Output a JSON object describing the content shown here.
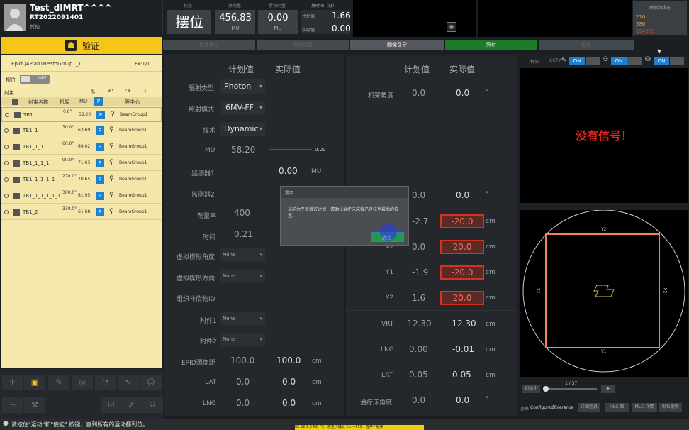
{
  "patient": {
    "name": "Test_dIMRT^^^^",
    "id": "RT2022091401",
    "category": "其他"
  },
  "status": {
    "state_label": "状态",
    "state_value": "摆位",
    "total_label": "总剂量",
    "total_value": "456.83",
    "total_unit": "MU",
    "cum_label": "累积剂量",
    "cum_value": "0.00",
    "cum_unit": "MU",
    "time_label": "总时间（分）",
    "plan_label": "计划值",
    "plan_value": "1.66",
    "actual_label": "实际值",
    "actual_value": "0.00"
  },
  "linkstatus": {
    "title": "联锁和状态",
    "v1": "210",
    "v2": "280",
    "v3": "194000"
  },
  "verify_label": "验证",
  "workflow": [
    "患者摆位",
    "预先设置",
    "图像引导",
    "照射",
    "记录"
  ],
  "plan": {
    "name": "EpidQAPlan1BeamGroup1_1",
    "fx": "Fx:1/1",
    "setup_label": "摆位",
    "toggle": "OFF",
    "beam_label": "射束"
  },
  "beam_headers": {
    "name": "射束名称",
    "gantry": "机架",
    "mu": "MU",
    "p": "P",
    "iso": "等中心"
  },
  "beams": [
    {
      "name": "TB1",
      "gantry": "0.0°",
      "mu": "58.20",
      "p": "P",
      "group": "BeamGroup1"
    },
    {
      "name": "TB1_1",
      "gantry": "30.0°",
      "mu": "63.69",
      "p": "P",
      "group": "BeamGroup1"
    },
    {
      "name": "TB1_1_1",
      "gantry": "60.0°",
      "mu": "69.02",
      "p": "P",
      "group": "BeamGroup1"
    },
    {
      "name": "TB1_1_1_1",
      "gantry": "90.0°",
      "mu": "71.63",
      "p": "P",
      "group": "BeamGroup1"
    },
    {
      "name": "TB1_1_1_1_1",
      "gantry": "270.0°",
      "mu": "70.65",
      "p": "P",
      "group": "BeamGroup1"
    },
    {
      "name": "TB1_1_1_1_1_1",
      "gantry": "300.0°",
      "mu": "61.95",
      "p": "P",
      "group": "BeamGroup1"
    },
    {
      "name": "TB1_2",
      "gantry": "330.0°",
      "mu": "61.68",
      "p": "P",
      "group": "BeamGroup1"
    }
  ],
  "left_col": {
    "plan_hdr": "计划值",
    "act_hdr": "实际值",
    "radtype_label": "辐射类型",
    "radtype": "Photon",
    "mode_label": "照射模式",
    "mode": "6MV-FF",
    "tech_label": "技术",
    "tech": "Dynamic",
    "mu_label": "MU",
    "mu_plan": "58.20",
    "mu_prog": "0.00",
    "m1_label": "监测器1",
    "m1_act": "0.00",
    "m1_unit": "MU",
    "m2_label": "监测器2",
    "rate_label": "剂量率",
    "rate_plan": "400",
    "time_label": "时间",
    "time_plan": "0.21",
    "wedge_angle_label": "虚拟楔形角度",
    "wedge_angle": "None",
    "wedge_dir_label": "虚拟楔形方向",
    "wedge_dir": "None",
    "comp_label": "组织补偿物ID",
    "acc1_label": "附件1",
    "acc1": "None",
    "acc2_label": "附件2",
    "acc2": "None",
    "epid_label": "EPID源像距",
    "epid_plan": "100.0",
    "epid_act": "100.0",
    "epid_unit": "cm",
    "lat_label": "LAT",
    "lat_plan": "0.0",
    "lat_act": "0.0",
    "lat_unit": "cm",
    "lng_label": "LNG",
    "lng_plan": "0.0",
    "lng_act": "0.0",
    "lng_unit": "cm"
  },
  "right_col": {
    "plan_hdr": "计划值",
    "act_hdr": "实际值",
    "gantry_label": "机架角度",
    "gantry_plan": "0.0",
    "gantry_act": "0.0",
    "deg": "°",
    "coll_plan": "0.0",
    "coll_act": "0.0",
    "x1_label": "X1",
    "x1_plan": "-2.7",
    "x1_act": "-20.0",
    "x2_label": "X2",
    "x2_plan": "0.0",
    "x2_act": "20.0",
    "y1_label": "Y1",
    "y1_plan": "-1.9",
    "y1_act": "-20.0",
    "y2_label": "Y2",
    "y2_plan": "1.6",
    "y2_act": "20.0",
    "cm": "cm",
    "vrt_label": "VRT",
    "vrt_plan": "-12.30",
    "vrt_act": "-12.30",
    "lng_label": "LNG",
    "lng_plan": "0.00",
    "lng_act": "-0.01",
    "lat_label": "LAT",
    "lat_plan": "0.05",
    "lat_act": "0.05",
    "couch_label": "治疗床角度",
    "couch_plan": "0.0",
    "couch_act": "0.0"
  },
  "dialog": {
    "title": "提示",
    "message": "当前为平板验证计划，请确认治疗床床板已经拉至最后的位置。",
    "ok": "确定"
  },
  "video": {
    "gantry": "机架",
    "cctv": "CCTV",
    "on": "ON",
    "no_signal": "没有信号！"
  },
  "bev": {
    "x1": "X1",
    "x2": "X2",
    "y1": "Y1",
    "y2": "Y2"
  },
  "player": {
    "init": "初始化",
    "counter": "1 / 37"
  },
  "tolerance": {
    "label": "容差",
    "value": "ConfiguredTolerance",
    "b1": "详细信息",
    "b2": "MLC 图",
    "b3": "MLC 详情",
    "b4": "默认射野"
  },
  "statusbar": {
    "message": "请按住\"运动\"和\"使能\" 按键，直到所有的运动都到位。",
    "bottom": "02:32  9.5 MB    F5：发生 / 确认 Ctrl+F10：暂停 / 继续"
  }
}
